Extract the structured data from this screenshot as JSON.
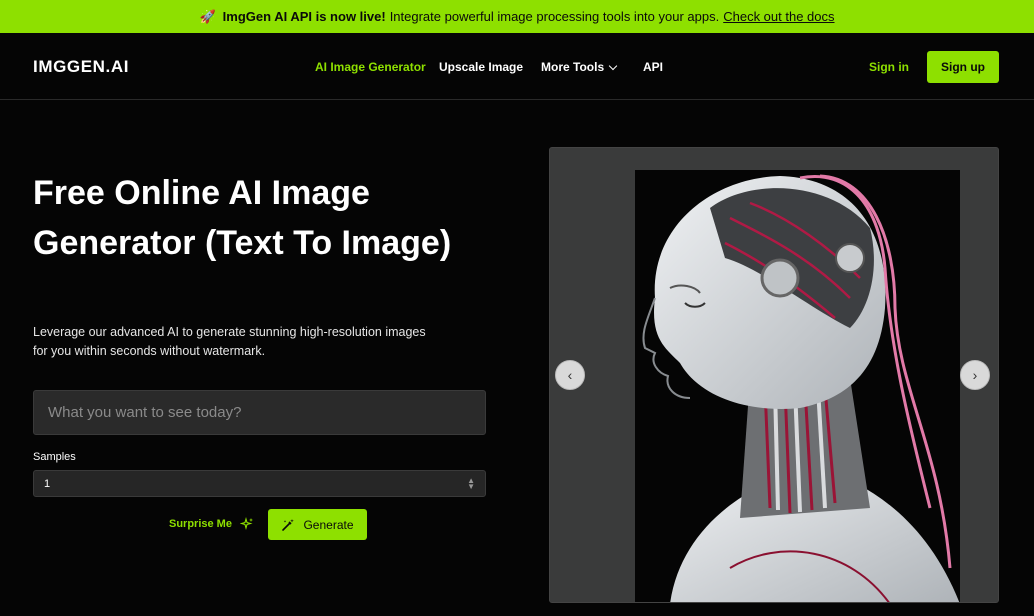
{
  "announcement": {
    "icon": "rocket-icon",
    "bold": "ImgGen AI API is now live!",
    "text": "Integrate powerful image processing tools into your apps.",
    "link": "Check out the docs"
  },
  "nav": {
    "logo": "IMGGEN.AI",
    "links": [
      "AI Image Generator",
      "Upscale Image",
      "More Tools",
      "API"
    ],
    "sign_in": "Sign in",
    "sign_up": "Sign up"
  },
  "hero": {
    "title": "Free Online AI Image Generator (Text To Image)",
    "description": "Leverage our advanced AI to generate stunning high-resolution images for you within seconds without watermark."
  },
  "form": {
    "prompt_placeholder": "What you want to see today?",
    "prompt_value": "",
    "samples_label": "Samples",
    "samples_value": "1",
    "surprise_label": "Surprise Me",
    "generate_label": "Generate"
  },
  "gallery": {
    "prev_icon": "chevron-left-icon",
    "next_icon": "chevron-right-icon"
  },
  "colors": {
    "accent": "#8ee000",
    "background": "#050505"
  }
}
